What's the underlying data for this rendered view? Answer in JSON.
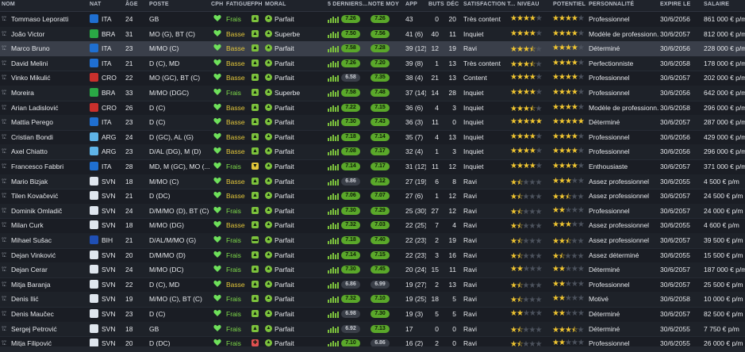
{
  "columns": {
    "nom": "NOM",
    "nat": "NAT",
    "age": "ÂGE",
    "poste": "POSTE",
    "cph": "CPH",
    "fatigue": "FATIGUE",
    "fph": "FPH",
    "moral": "MORAL",
    "derniers": "5 DERNIERS...",
    "note": "NOTE MOY",
    "app": "APP",
    "buts": "BUTS",
    "dec": "DÉC",
    "satisfaction": "SATISFACTION T...",
    "niveau": "NIVEAU",
    "potentiel": "POTENTIEL",
    "personnalite": "PERSONNALITÉ",
    "expire": "EXPIRE LE",
    "salaire": "SALAIRE"
  },
  "colors": {
    "cph_green": "#6ee05a",
    "fatigue_frais": "#7fdc4a",
    "fatigue_basse": "#e2c63a",
    "star": "#f1c631"
  },
  "players": [
    {
      "name": "Tommaso Leporatti",
      "nat": "ITA",
      "flag": "#1f6fd1",
      "age": "24",
      "pos": "GB",
      "fatigue": "Frais",
      "fph": "▲",
      "fph_color": "#7cc23c",
      "moral": "Parfait",
      "moral_icon": "▲",
      "moral_color": "#7cc23c",
      "last5": "7.26",
      "last5_color": "#5aa82a",
      "note": "7.26",
      "note_color": "#5aa82a",
      "app": "43",
      "buts": "0",
      "dec": "20",
      "sat": "Très content",
      "niv": 4,
      "pot": 4,
      "pers": "Professionnel",
      "exp": "30/6/2056",
      "sal": "861 000 € p/m"
    },
    {
      "name": "João Victor",
      "nat": "BRA",
      "flag": "#2aa845",
      "age": "31",
      "pos": "MO (G), BT (C)",
      "fatigue": "Basse",
      "fph": "▲",
      "fph_color": "#7cc23c",
      "moral": "Superbe",
      "moral_icon": "▲",
      "moral_color": "#7cc23c",
      "last5": "7.50",
      "last5_color": "#5aa82a",
      "note": "7.56",
      "note_color": "#5aa82a",
      "app": "41 (6)",
      "buts": "40",
      "dec": "11",
      "sat": "Inquiet",
      "niv": 4,
      "pot": 4,
      "pers": "Modèle de professionn...",
      "exp": "30/6/2057",
      "sal": "812 000 € p/m"
    },
    {
      "name": "Marco Bruno",
      "nat": "ITA",
      "flag": "#1f6fd1",
      "age": "23",
      "pos": "M/MO (C)",
      "fatigue": "Basse",
      "fph": "▲",
      "fph_color": "#7cc23c",
      "moral": "Parfait",
      "moral_icon": "▲",
      "moral_color": "#7cc23c",
      "last5": "7.58",
      "last5_color": "#5aa82a",
      "note": "7.28",
      "note_color": "#5aa82a",
      "app": "39 (12)",
      "buts": "12",
      "dec": "19",
      "sat": "Ravi",
      "niv": 3.5,
      "pot": 4,
      "pers": "Déterminé",
      "exp": "30/6/2056",
      "sal": "228 000 € p/m"
    },
    {
      "name": "David Melini",
      "nat": "ITA",
      "flag": "#1f6fd1",
      "age": "21",
      "pos": "D (C), MD",
      "fatigue": "Basse",
      "fph": "▲",
      "fph_color": "#7cc23c",
      "moral": "Parfait",
      "moral_icon": "▲",
      "moral_color": "#7cc23c",
      "last5": "7.26",
      "last5_color": "#5aa82a",
      "note": "7.20",
      "note_color": "#5aa82a",
      "app": "39 (8)",
      "buts": "1",
      "dec": "13",
      "sat": "Très content",
      "niv": 3.5,
      "pot": 4,
      "pers": "Perfectionniste",
      "exp": "30/6/2058",
      "sal": "178 000 € p/m"
    },
    {
      "name": "Vinko Mikulić",
      "nat": "CRO",
      "flag": "#c9302c",
      "age": "22",
      "pos": "MO (GC), BT (C)",
      "fatigue": "Basse",
      "fph": "▲",
      "fph_color": "#7cc23c",
      "moral": "Parfait",
      "moral_icon": "▲",
      "moral_color": "#7cc23c",
      "last5": "6.58",
      "last5_color": "#3a3f48",
      "note": "7.35",
      "note_color": "#5aa82a",
      "app": "38 (4)",
      "buts": "21",
      "dec": "13",
      "sat": "Content",
      "niv": 4,
      "pot": 4,
      "pers": "Professionnel",
      "exp": "30/6/2057",
      "sal": "202 000 € p/m"
    },
    {
      "name": "Moreira",
      "nat": "BRA",
      "flag": "#2aa845",
      "age": "33",
      "pos": "M/MO (DGC)",
      "fatigue": "Frais",
      "fph": "▲",
      "fph_color": "#7cc23c",
      "moral": "Superbe",
      "moral_icon": "▲",
      "moral_color": "#7cc23c",
      "last5": "7.58",
      "last5_color": "#5aa82a",
      "note": "7.48",
      "note_color": "#5aa82a",
      "app": "37 (14)",
      "buts": "14",
      "dec": "28",
      "sat": "Inquiet",
      "niv": 4,
      "pot": 4,
      "pers": "Professionnel",
      "exp": "30/6/2056",
      "sal": "642 000 € p/m"
    },
    {
      "name": "Arian Ladislović",
      "nat": "CRO",
      "flag": "#c9302c",
      "age": "26",
      "pos": "D (C)",
      "fatigue": "Basse",
      "fph": "▲",
      "fph_color": "#7cc23c",
      "moral": "Parfait",
      "moral_icon": "▲",
      "moral_color": "#7cc23c",
      "last5": "7.22",
      "last5_color": "#5aa82a",
      "note": "7.15",
      "note_color": "#5aa82a",
      "app": "36 (6)",
      "buts": "4",
      "dec": "3",
      "sat": "Inquiet",
      "niv": 3.5,
      "pot": 4,
      "pers": "Modèle de professionn...",
      "exp": "30/6/2058",
      "sal": "296 000 € p/m"
    },
    {
      "name": "Mattia Perego",
      "nat": "ITA",
      "flag": "#1f6fd1",
      "age": "23",
      "pos": "D (C)",
      "fatigue": "Basse",
      "fph": "▲",
      "fph_color": "#7cc23c",
      "moral": "Parfait",
      "moral_icon": "▲",
      "moral_color": "#7cc23c",
      "last5": "7.30",
      "last5_color": "#5aa82a",
      "note": "7.43",
      "note_color": "#5aa82a",
      "app": "36 (3)",
      "buts": "11",
      "dec": "0",
      "sat": "Inquiet",
      "niv": 5,
      "pot": 5,
      "pers": "Déterminé",
      "exp": "30/6/2057",
      "sal": "287 000 € p/m"
    },
    {
      "name": "Cristian Bondi",
      "nat": "ARG",
      "flag": "#5fb4e8",
      "age": "24",
      "pos": "D (GC), AL (G)",
      "fatigue": "Basse",
      "fph": "▲",
      "fph_color": "#7cc23c",
      "moral": "Parfait",
      "moral_icon": "▲",
      "moral_color": "#7cc23c",
      "last5": "7.18",
      "last5_color": "#5aa82a",
      "note": "7.14",
      "note_color": "#5aa82a",
      "app": "35 (7)",
      "buts": "4",
      "dec": "13",
      "sat": "Inquiet",
      "niv": 4,
      "pot": 4,
      "pers": "Professionnel",
      "exp": "30/6/2056",
      "sal": "429 000 € p/m"
    },
    {
      "name": "Axel Chiatto",
      "nat": "ARG",
      "flag": "#5fb4e8",
      "age": "23",
      "pos": "D/AL (DG), M (D)",
      "fatigue": "Basse",
      "fph": "▲",
      "fph_color": "#7cc23c",
      "moral": "Parfait",
      "moral_icon": "▲",
      "moral_color": "#7cc23c",
      "last5": "7.08",
      "last5_color": "#5aa82a",
      "note": "7.17",
      "note_color": "#5aa82a",
      "app": "32 (4)",
      "buts": "1",
      "dec": "3",
      "sat": "Inquiet",
      "niv": 4,
      "pot": 4,
      "pers": "Professionnel",
      "exp": "30/6/2056",
      "sal": "296 000 € p/m"
    },
    {
      "name": "Francesco Fabbri",
      "nat": "ITA",
      "flag": "#1f6fd1",
      "age": "28",
      "pos": "MD, M (GC), MO (...",
      "fatigue": "Frais",
      "fph": "▼",
      "fph_color": "#e2c63a",
      "moral": "Parfait",
      "moral_icon": "▲",
      "moral_color": "#7cc23c",
      "last5": "7.14",
      "last5_color": "#5aa82a",
      "note": "7.17",
      "note_color": "#5aa82a",
      "app": "31 (12)",
      "buts": "11",
      "dec": "12",
      "sat": "Inquiet",
      "niv": 4,
      "pot": 4,
      "pers": "Enthousiaste",
      "exp": "30/6/2057",
      "sal": "371 000 € p/m"
    },
    {
      "name": "Mario Bizjak",
      "nat": "SVN",
      "flag": "#dfe6ee",
      "age": "18",
      "pos": "M/MO (C)",
      "fatigue": "Basse",
      "fph": "▲",
      "fph_color": "#7cc23c",
      "moral": "Parfait",
      "moral_icon": "▲",
      "moral_color": "#7cc23c",
      "last5": "6.86",
      "last5_color": "#3a3f48",
      "note": "7.12",
      "note_color": "#5aa82a",
      "app": "27 (19)",
      "buts": "6",
      "dec": "8",
      "sat": "Ravi",
      "niv": 1.5,
      "pot": 3,
      "pers": "Assez professionnel",
      "exp": "30/6/2055",
      "sal": "4 500 € p/m"
    },
    {
      "name": "Tilen Kovačević",
      "nat": "SVN",
      "flag": "#dfe6ee",
      "age": "21",
      "pos": "D (DC)",
      "fatigue": "Basse",
      "fph": "▲",
      "fph_color": "#7cc23c",
      "moral": "Parfait",
      "moral_icon": "▲",
      "moral_color": "#7cc23c",
      "last5": "7.06",
      "last5_color": "#5aa82a",
      "note": "7.07",
      "note_color": "#5aa82a",
      "app": "27 (6)",
      "buts": "1",
      "dec": "12",
      "sat": "Ravi",
      "niv": 1.5,
      "pot": 2.5,
      "pers": "Assez professionnel",
      "exp": "30/6/2057",
      "sal": "24 500 € p/m"
    },
    {
      "name": "Dominik Omladič",
      "nat": "SVN",
      "flag": "#dfe6ee",
      "age": "24",
      "pos": "D/M/MO (D), BT (C)",
      "fatigue": "Frais",
      "fph": "▲",
      "fph_color": "#7cc23c",
      "moral": "Parfait",
      "moral_icon": "▲",
      "moral_color": "#7cc23c",
      "last5": "7.30",
      "last5_color": "#5aa82a",
      "note": "7.29",
      "note_color": "#5aa82a",
      "app": "25 (30)",
      "buts": "27",
      "dec": "12",
      "sat": "Ravi",
      "niv": 1.5,
      "pot": 2,
      "pers": "Professionnel",
      "exp": "30/6/2057",
      "sal": "24 000 € p/m"
    },
    {
      "name": "Milan Curk",
      "nat": "SVN",
      "flag": "#dfe6ee",
      "age": "18",
      "pos": "M/MO (DG)",
      "fatigue": "Basse",
      "fph": "▲",
      "fph_color": "#7cc23c",
      "moral": "Parfait",
      "moral_icon": "▲",
      "moral_color": "#7cc23c",
      "last5": "7.32",
      "last5_color": "#5aa82a",
      "note": "7.03",
      "note_color": "#5aa82a",
      "app": "22 (25)",
      "buts": "7",
      "dec": "4",
      "sat": "Ravi",
      "niv": 1.5,
      "pot": 3,
      "pers": "Assez professionnel",
      "exp": "30/6/2055",
      "sal": "4 600 € p/m"
    },
    {
      "name": "Mihael Sušac",
      "nat": "BIH",
      "flag": "#1f4fb5",
      "age": "21",
      "pos": "D/AL/M/MO (G)",
      "fatigue": "Frais",
      "fph": "▬",
      "fph_color": "#7cc23c",
      "moral": "Parfait",
      "moral_icon": "▲",
      "moral_color": "#7cc23c",
      "last5": "7.18",
      "last5_color": "#5aa82a",
      "note": "7.40",
      "note_color": "#5aa82a",
      "app": "22 (23)",
      "buts": "2",
      "dec": "19",
      "sat": "Ravi",
      "niv": 1.5,
      "pot": 2.5,
      "pers": "Assez professionnel",
      "exp": "30/6/2057",
      "sal": "39 500 € p/m"
    },
    {
      "name": "Dejan Vinković",
      "nat": "SVN",
      "flag": "#dfe6ee",
      "age": "20",
      "pos": "D/M/MO (D)",
      "fatigue": "Frais",
      "fph": "▲",
      "fph_color": "#7cc23c",
      "moral": "Parfait",
      "moral_icon": "▲",
      "moral_color": "#7cc23c",
      "last5": "7.14",
      "last5_color": "#5aa82a",
      "note": "7.15",
      "note_color": "#5aa82a",
      "app": "22 (23)",
      "buts": "3",
      "dec": "16",
      "sat": "Ravi",
      "niv": 1.5,
      "pot": 1.5,
      "pers": "Assez déterminé",
      "exp": "30/6/2055",
      "sal": "15 500 € p/m"
    },
    {
      "name": "Dejan Cerar",
      "nat": "SVN",
      "flag": "#dfe6ee",
      "age": "24",
      "pos": "M/MO (DC)",
      "fatigue": "Frais",
      "fph": "▲",
      "fph_color": "#7cc23c",
      "moral": "Parfait",
      "moral_icon": "▲",
      "moral_color": "#7cc23c",
      "last5": "7.30",
      "last5_color": "#5aa82a",
      "note": "7.45",
      "note_color": "#5aa82a",
      "app": "20 (24)",
      "buts": "15",
      "dec": "11",
      "sat": "Ravi",
      "niv": 2,
      "pot": 2,
      "pers": "Déterminé",
      "exp": "30/6/2057",
      "sal": "187 000 € p/m"
    },
    {
      "name": "Mitja Baranja",
      "nat": "SVN",
      "flag": "#dfe6ee",
      "age": "22",
      "pos": "D (C), MD",
      "fatigue": "Basse",
      "fph": "▲",
      "fph_color": "#7cc23c",
      "moral": "Parfait",
      "moral_icon": "▲",
      "moral_color": "#7cc23c",
      "last5": "6.86",
      "last5_color": "#3a3f48",
      "note": "6.99",
      "note_color": "#3a3f48",
      "app": "19 (27)",
      "buts": "2",
      "dec": "13",
      "sat": "Ravi",
      "niv": 1.5,
      "pot": 2,
      "pers": "Professionnel",
      "exp": "30/6/2057",
      "sal": "25 500 € p/m"
    },
    {
      "name": "Denis Ilić",
      "nat": "SVN",
      "flag": "#dfe6ee",
      "age": "19",
      "pos": "M/MO (C), BT (C)",
      "fatigue": "Frais",
      "fph": "▲",
      "fph_color": "#7cc23c",
      "moral": "Parfait",
      "moral_icon": "▲",
      "moral_color": "#7cc23c",
      "last5": "7.32",
      "last5_color": "#5aa82a",
      "note": "7.10",
      "note_color": "#5aa82a",
      "app": "19 (25)",
      "buts": "18",
      "dec": "5",
      "sat": "Ravi",
      "niv": 1.5,
      "pot": 2,
      "pers": "Motivé",
      "exp": "30/6/2058",
      "sal": "10 000 € p/m"
    },
    {
      "name": "Denis Maučec",
      "nat": "SVN",
      "flag": "#dfe6ee",
      "age": "23",
      "pos": "D (C)",
      "fatigue": "Frais",
      "fph": "▲",
      "fph_color": "#7cc23c",
      "moral": "Parfait",
      "moral_icon": "▲",
      "moral_color": "#7cc23c",
      "last5": "6.98",
      "last5_color": "#3a3f48",
      "note": "7.30",
      "note_color": "#5aa82a",
      "app": "19 (3)",
      "buts": "5",
      "dec": "5",
      "sat": "Ravi",
      "niv": 2,
      "pot": 2,
      "pers": "Déterminé",
      "exp": "30/6/2057",
      "sal": "82 500 € p/m"
    },
    {
      "name": "Sergej Petrović",
      "nat": "SVN",
      "flag": "#dfe6ee",
      "age": "18",
      "pos": "GB",
      "fatigue": "Frais",
      "fph": "▲",
      "fph_color": "#7cc23c",
      "moral": "Parfait",
      "moral_icon": "▲",
      "moral_color": "#7cc23c",
      "last5": "6.92",
      "last5_color": "#3a3f48",
      "note": "7.13",
      "note_color": "#5aa82a",
      "app": "17",
      "buts": "0",
      "dec": "0",
      "sat": "Ravi",
      "niv": 1.5,
      "pot": 3.5,
      "pers": "Déterminé",
      "exp": "30/6/2055",
      "sal": "7 750 € p/m"
    },
    {
      "name": "Mitja Filipović",
      "nat": "SVN",
      "flag": "#dfe6ee",
      "age": "20",
      "pos": "D (DC)",
      "fatigue": "Frais",
      "fph": "✚",
      "fph_color": "#e05050",
      "moral": "Parfait",
      "moral_icon": "▲",
      "moral_color": "#7cc23c",
      "last5": "7.10",
      "last5_color": "#5aa82a",
      "note": "6.86",
      "note_color": "#3a3f48",
      "app": "16 (2)",
      "buts": "2",
      "dec": "0",
      "sat": "Ravi",
      "niv": 1.5,
      "pot": 2,
      "pers": "Professionnel",
      "exp": "30/6/2055",
      "sal": "26 000 € p/m"
    }
  ]
}
